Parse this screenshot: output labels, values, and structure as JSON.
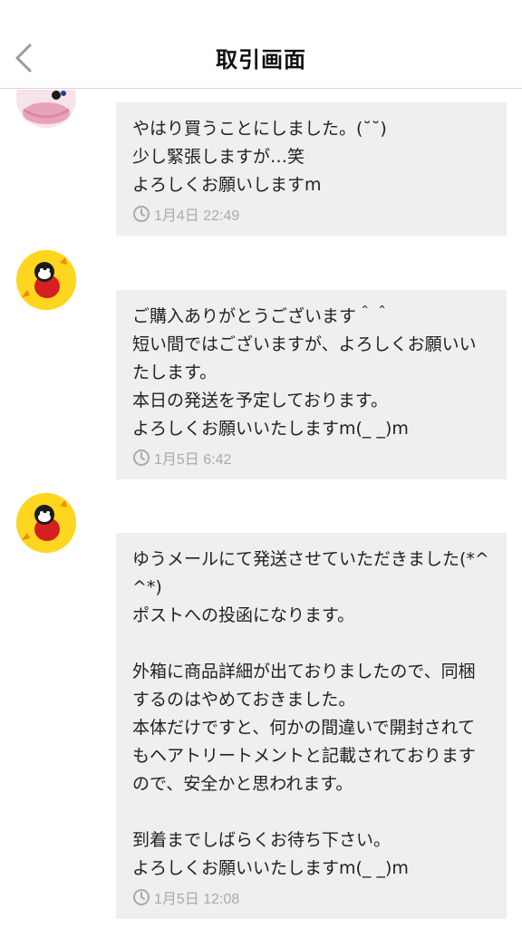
{
  "header": {
    "title": "取引画面",
    "back_icon": "chevron-left-icon"
  },
  "colors": {
    "bubble": "#efefef",
    "timestamp": "#aaaaaa",
    "divider": "#d6d6d6"
  },
  "messages": [
    {
      "sender": "me",
      "text": "やはり買うことにしました。(˘˘)\n少し緊張しますが…笑\nよろしくお願いしますm",
      "time": "1月4日 22:49"
    },
    {
      "sender": "partner",
      "text": "ご購入ありがとうございます＾＾\n短い間ではございますが、よろしくお願いいたします。\n本日の発送を予定しております。\nよろしくお願いいたしますm(_ _)m",
      "time": "1月5日 6:42"
    },
    {
      "sender": "partner",
      "text": "ゆうメールにて発送させていただきました(*^^*)\nポストへの投函になります。\n\n外箱に商品詳細が出ておりましたので、同梱するのはやめておきました。\n本体だけですと、何かの間違いで開封されてもヘアトリートメントと記載されておりますので、安全かと思われます。\n\n到着までしばらくお待ち下さい。\nよろしくお願いいたしますm(_ _)m",
      "time": "1月5日 12:08"
    }
  ]
}
